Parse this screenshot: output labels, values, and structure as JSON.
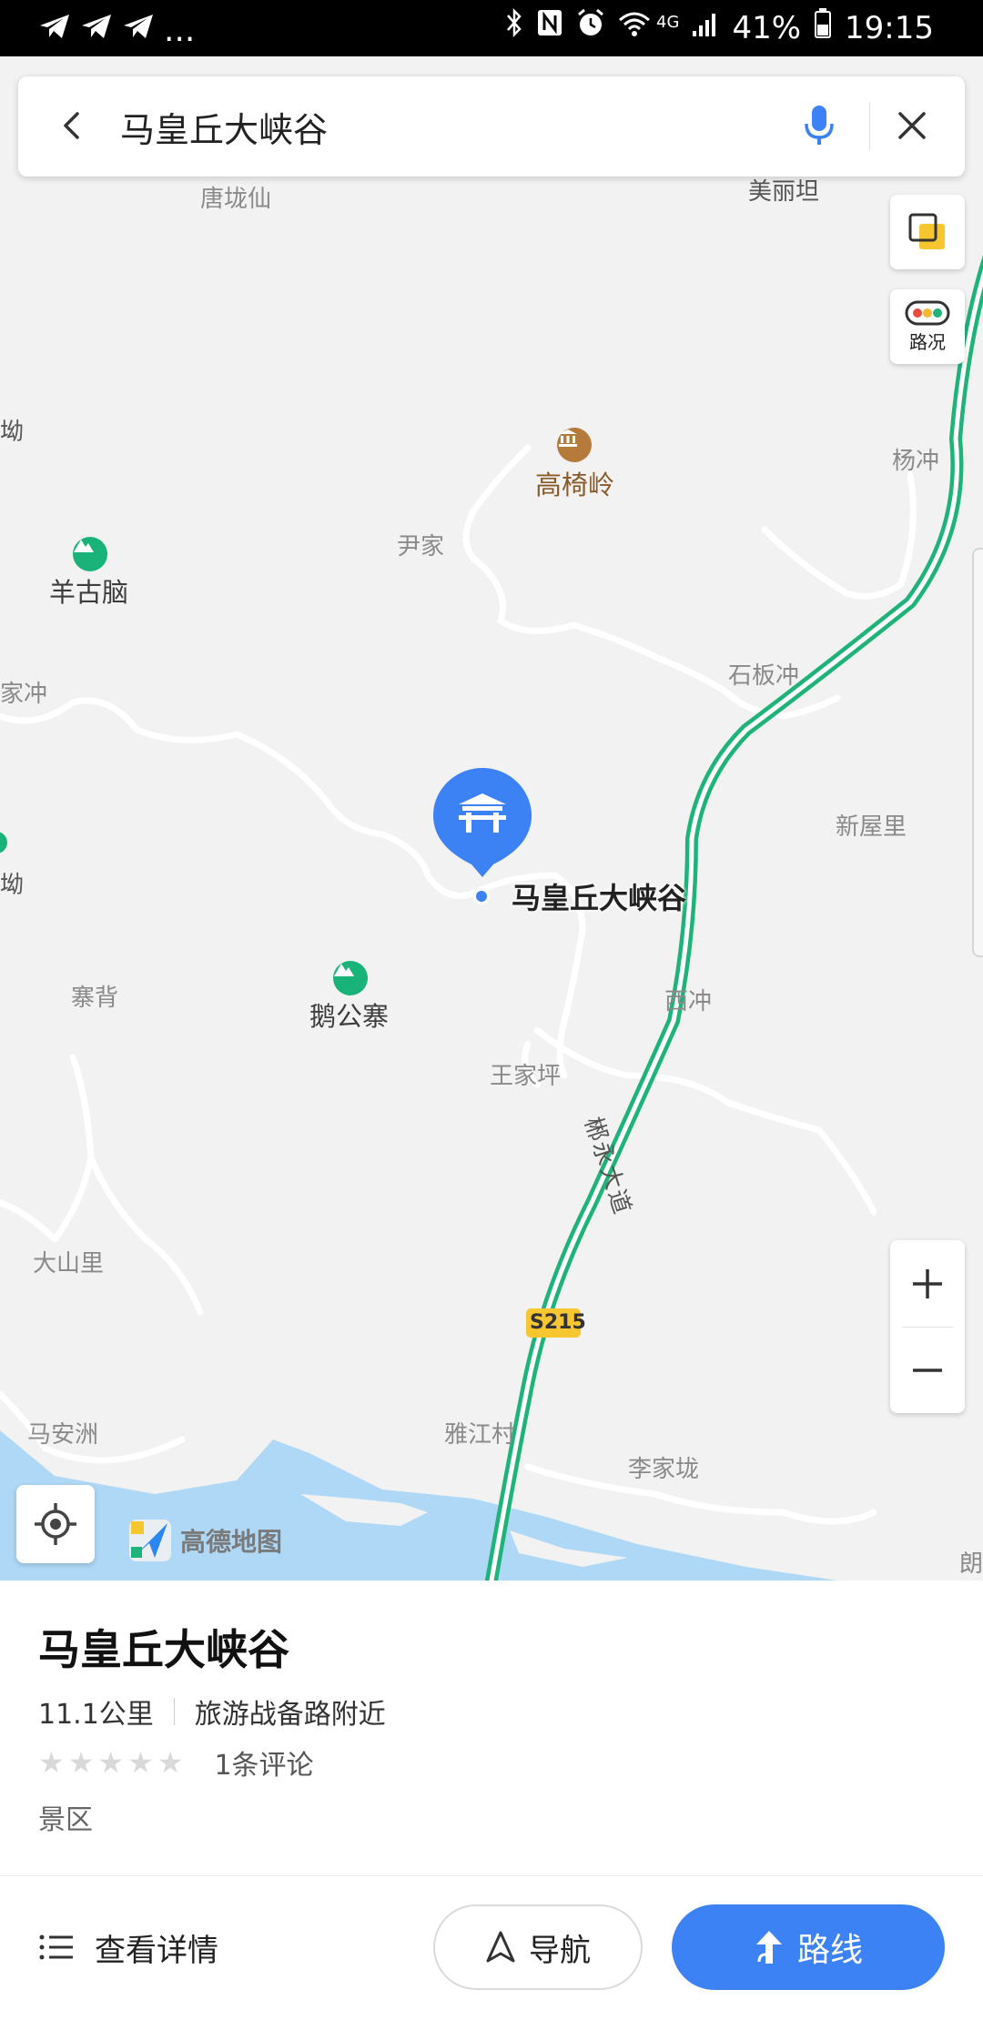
{
  "status_bar": {
    "left_icons": [
      "telegram-icon",
      "telegram-icon",
      "telegram-icon"
    ],
    "ellipsis": "...",
    "network": "4G",
    "battery": "41%",
    "time": "19:15"
  },
  "search": {
    "query": "马皇丘大峡谷"
  },
  "map_tools": {
    "traffic_label": "路况"
  },
  "map_labels": {
    "tanglongxian": "唐垅仙",
    "meilitan": "美丽坦",
    "ao_top": "坳",
    "gaoyiling": "高椅岭",
    "yangchong": "杨冲",
    "yinjia": "尹家",
    "yanggunao": "羊古脑",
    "jiachong": "家冲",
    "shibanchong": "石板冲",
    "xinwuli": "新屋里",
    "ao_mid": "坳",
    "marker_name": "马皇丘大峡谷",
    "zhaibei": "寨背",
    "egongzhai": "鹅公寨",
    "xichong": "西冲",
    "wangjiaping": "王家坪",
    "road_name": "郴永大道",
    "dashanli": "大山里",
    "road_code": "S215",
    "maanzhou": "马安洲",
    "yajiangcun": "雅江村",
    "lijialong": "李家垅",
    "lang": "朗"
  },
  "logo": {
    "text": "高德地图"
  },
  "poi": {
    "name": "马皇丘大峡谷",
    "distance": "11.1公里",
    "address": "旅游战备路附近",
    "rating": 0,
    "reviews": "1条评论",
    "category": "景区"
  },
  "actions": {
    "details": "查看详情",
    "navigate": "导航",
    "route": "路线"
  },
  "colors": {
    "accent": "#3c82f5",
    "highway": "#1fb37a",
    "water": "#aed8f5",
    "road_sign": "#f7c631"
  }
}
